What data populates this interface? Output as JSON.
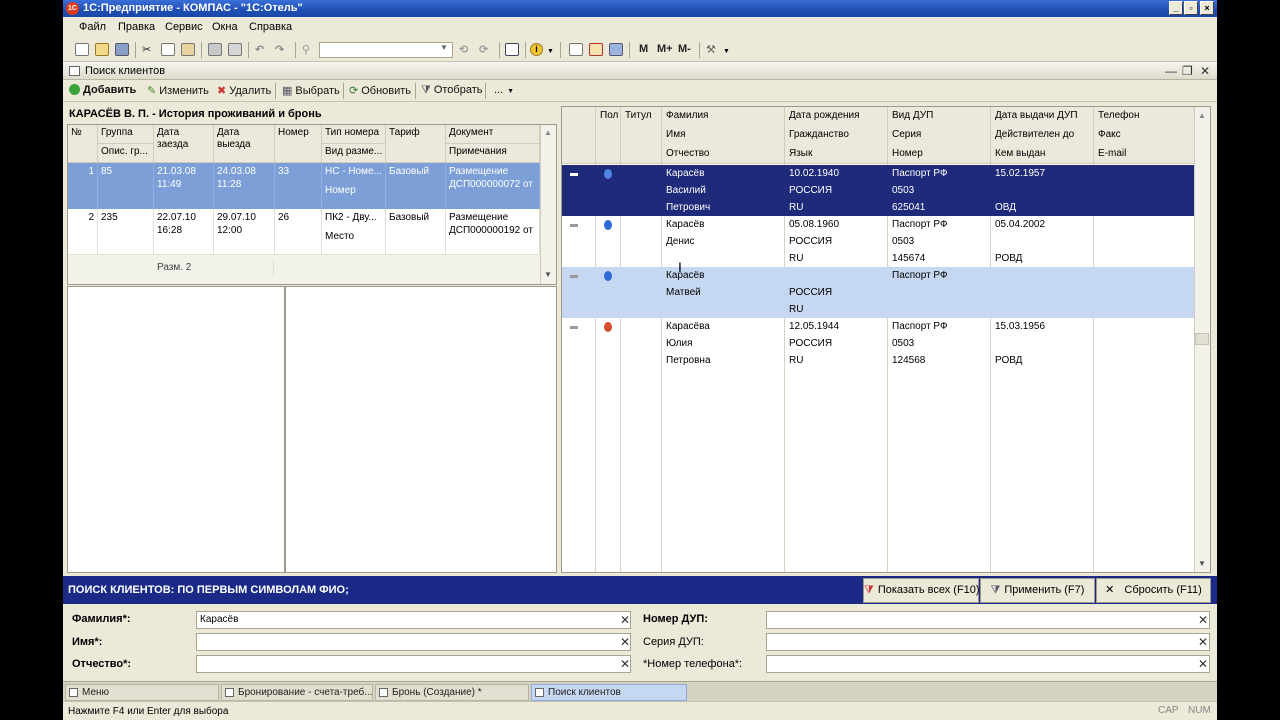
{
  "window": {
    "title": "1С:Предприятие - КОМПАС - \"1С:Отель\""
  },
  "menu": [
    "Файл",
    "Правка",
    "Сервис",
    "Окна",
    "Справка"
  ],
  "toolbar": {
    "m": "M",
    "mplus": "M+",
    "mminus": "M-"
  },
  "form": {
    "title": "Поиск клиентов",
    "buttons": {
      "add": "Добавить",
      "edit": "Изменить",
      "delete": "Удалить",
      "select": "Выбрать",
      "refresh": "Обновить",
      "filter": "Отобрать",
      "more": "..."
    }
  },
  "history": {
    "title": "КАРАСЁВ В. П. - История проживаний и бронь",
    "headers": {
      "num": "№",
      "group": "Группа",
      "group2": "Опис. гр...",
      "checkin": "Дата заезда",
      "checkout": "Дата выезда",
      "room": "Номер",
      "roomtype": "Тип номера",
      "roomtype2": "Вид разме...",
      "tariff": "Тариф",
      "doc": "Документ",
      "doc2": "Примечания"
    },
    "rows": [
      {
        "num": "1",
        "group": "85",
        "checkin": "21.03.08 11:49",
        "checkout": "24.03.08 11:28",
        "room": "33",
        "roomtype": "НС - Номе...",
        "roomtype2": "Номер",
        "tariff": "Базовый",
        "doc": "Размещение ДСП000000072 от"
      },
      {
        "num": "2",
        "group": "235",
        "checkin": "22.07.10 16:28",
        "checkout": "29.07.10 12:00",
        "room": "26",
        "roomtype": "ПК2 - Дву...",
        "roomtype2": "Место",
        "tariff": "Базовый",
        "doc": "Размещение ДСП000000192 от"
      }
    ],
    "summary": "Разм. 2"
  },
  "clients": {
    "headers": {
      "sex": "Пол",
      "title": "Титул",
      "surname": "Фамилия",
      "name": "Имя",
      "patronymic": "Отчество",
      "birth": "Дата рождения",
      "citizenship": "Гражданство",
      "lang": "Язык",
      "doctype": "Вид ДУП",
      "series": "Серия",
      "number": "Номер",
      "issued": "Дата выдачи ДУП",
      "valid": "Действителен до",
      "issuer": "Кем выдан",
      "phone": "Телефон",
      "fax": "Факс",
      "email": "E-mail"
    },
    "rows": [
      {
        "surname": "Карасёв",
        "name": "Василий",
        "patronymic": "Петрович",
        "birth": "10.02.1940",
        "citizenship": "РОССИЯ",
        "lang": "RU",
        "doctype": "Паспорт РФ",
        "series": "0503",
        "number": "625041",
        "issued": "15.02.1957",
        "issuer": "ОВД"
      },
      {
        "surname": "Карасёв",
        "name": "Денис",
        "patronymic": "",
        "birth": "05.08.1960",
        "citizenship": "РОССИЯ",
        "lang": "RU",
        "doctype": "Паспорт РФ",
        "series": "0503",
        "number": "145674",
        "issued": "05.04.2002",
        "issuer": "РОВД"
      },
      {
        "surname": "Карасёв",
        "name": "Матвей",
        "patronymic": "",
        "birth": "",
        "citizenship": "РОССИЯ",
        "lang": "RU",
        "doctype": "Паспорт РФ",
        "series": "",
        "number": "",
        "issued": "",
        "issuer": ""
      },
      {
        "surname": "Карасёва",
        "name": "Юлия",
        "patronymic": "Петровна",
        "birth": "12.05.1944",
        "citizenship": "РОССИЯ",
        "lang": "RU",
        "doctype": "Паспорт РФ",
        "series": "0503",
        "number": "124568",
        "issued": "15.03.1956",
        "issuer": "РОВД"
      }
    ]
  },
  "search": {
    "banner": "ПОИСК КЛИЕНТОВ: ПО ПЕРВЫМ СИМВОЛАМ ФИО;",
    "show_all": "Показать всех (F10)",
    "apply": "Применить (F7)",
    "reset": "Сбросить (F11)",
    "surname_label": "Фамилия*:",
    "surname_value": "Карасёв",
    "name_label": "Имя*:",
    "name_value": "",
    "patronymic_label": "Отчество*:",
    "patronymic_value": "",
    "docnum_label": "Номер ДУП:",
    "docnum_value": "",
    "docseries_label": "Серия ДУП:",
    "docseries_value": "",
    "phone_label": "*Номер телефона*:",
    "phone_value": ""
  },
  "tasks": [
    "Меню",
    "Бронирование - счета-треб...",
    "Бронь (Создание) *",
    "Поиск клиентов"
  ],
  "status": {
    "text": "Нажмите F4 или Enter для выбора",
    "cap": "CAP",
    "num": "NUM"
  },
  "colors": {
    "selected_row": "#1F2A7A",
    "light_row": "#C6D7F2",
    "banner": "#1A2A86",
    "male": "#2E6CD8",
    "female": "#D84A2E"
  }
}
